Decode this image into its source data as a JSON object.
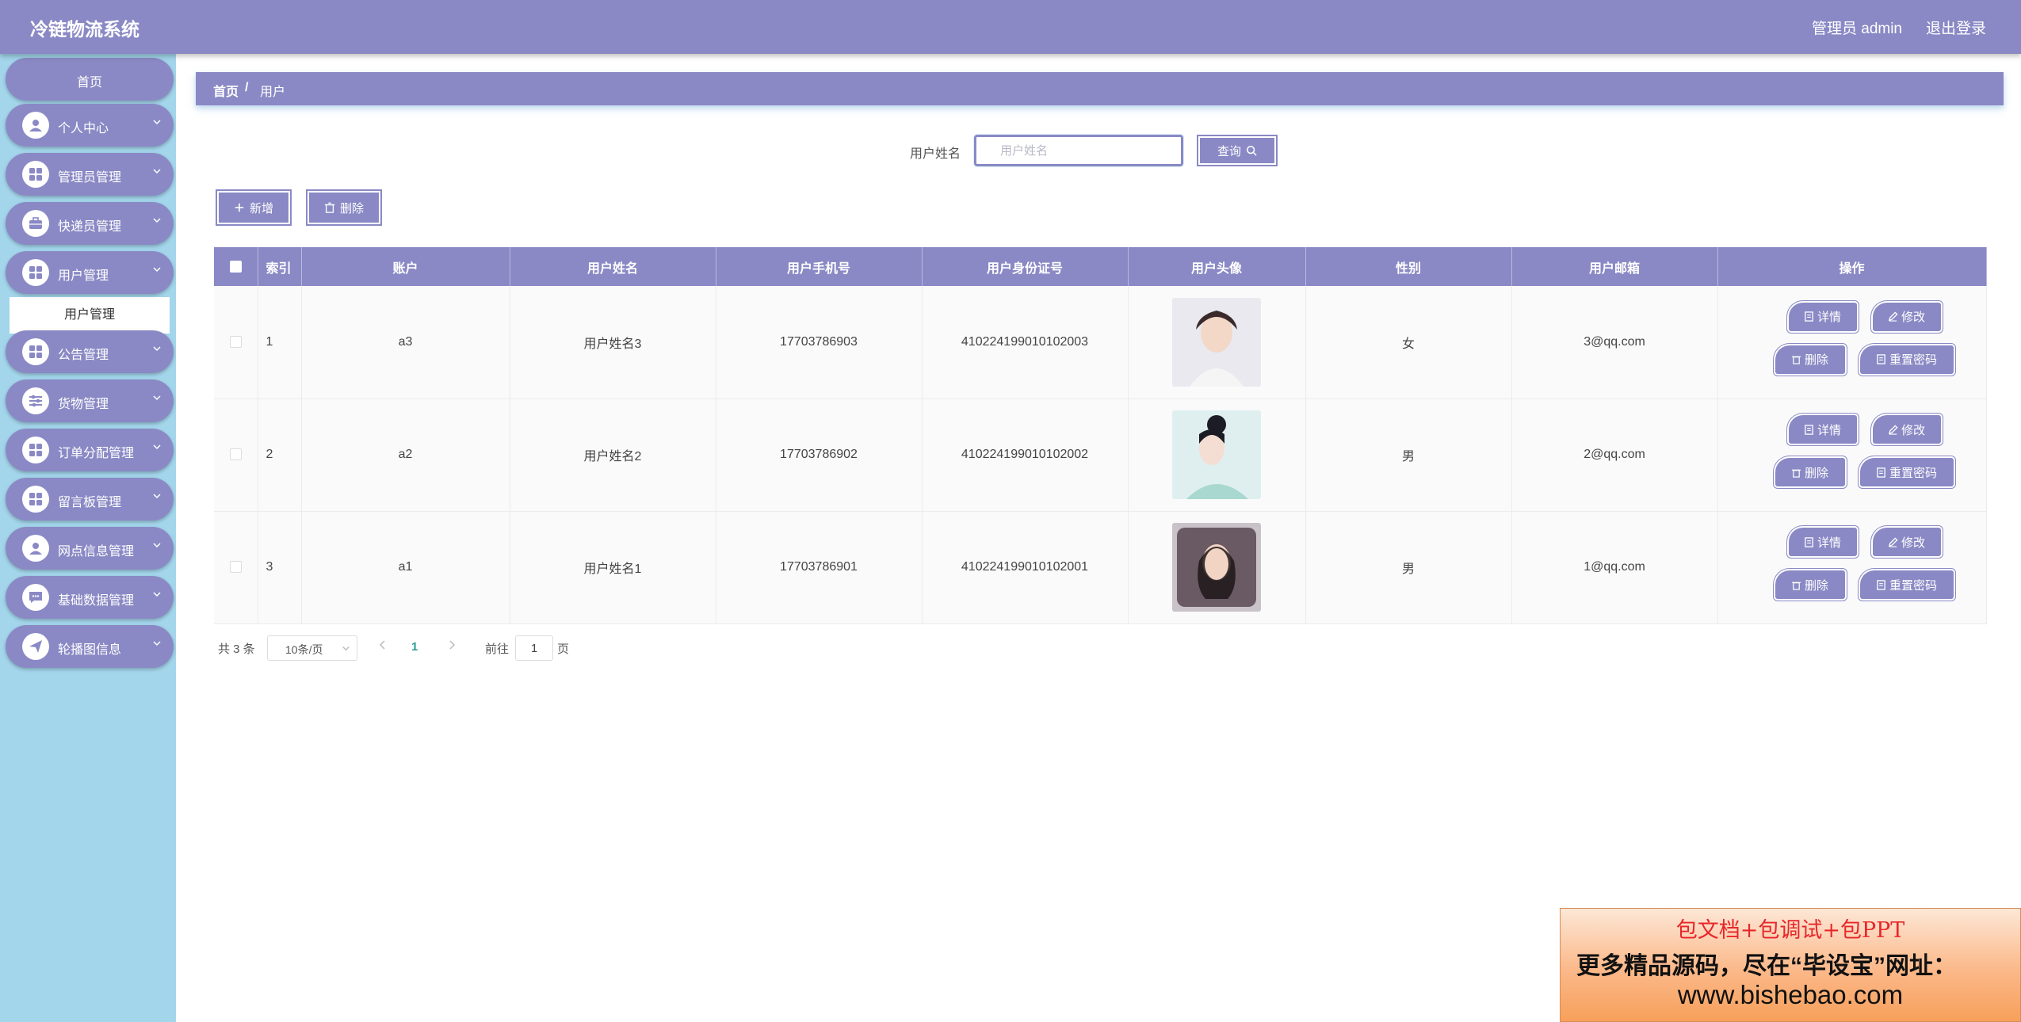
{
  "app": {
    "title": "冷链物流系统",
    "admin_label": "管理员 admin",
    "logout_label": "退出登录"
  },
  "sidebar": {
    "home": "首页",
    "items": [
      {
        "label": "个人中心",
        "icon": "person-icon"
      },
      {
        "label": "管理员管理",
        "icon": "grid-icon"
      },
      {
        "label": "快递员管理",
        "icon": "briefcase-icon"
      },
      {
        "label": "用户管理",
        "icon": "grid-icon"
      },
      {
        "label": "公告管理",
        "icon": "grid-icon"
      },
      {
        "label": "货物管理",
        "icon": "sliders-icon"
      },
      {
        "label": "订单分配管理",
        "icon": "grid-icon"
      },
      {
        "label": "留言板管理",
        "icon": "grid-icon"
      },
      {
        "label": "网点信息管理",
        "icon": "person-icon"
      },
      {
        "label": "基础数据管理",
        "icon": "chat-icon"
      },
      {
        "label": "轮播图信息",
        "icon": "send-icon"
      }
    ],
    "active_sub": "用户管理"
  },
  "breadcrumb": {
    "home": "首页",
    "sep": "/",
    "current": "用户"
  },
  "search": {
    "label": "用户姓名",
    "placeholder": "用户姓名",
    "value": "",
    "button": "查询"
  },
  "actions": {
    "add": "新增",
    "delete": "删除"
  },
  "table": {
    "headers": [
      "索引",
      "账户",
      "用户姓名",
      "用户手机号",
      "用户身份证号",
      "用户头像",
      "性别",
      "用户邮箱",
      "操作"
    ],
    "rows": [
      {
        "index": "1",
        "account": "a3",
        "name": "用户姓名3",
        "phone": "17703786903",
        "id_card": "410224199010102003",
        "gender": "女",
        "email": "3@qq.com"
      },
      {
        "index": "2",
        "account": "a2",
        "name": "用户姓名2",
        "phone": "17703786902",
        "id_card": "410224199010102002",
        "gender": "男",
        "email": "2@qq.com"
      },
      {
        "index": "3",
        "account": "a1",
        "name": "用户姓名1",
        "phone": "17703786901",
        "id_card": "410224199010102001",
        "gender": "男",
        "email": "1@qq.com"
      }
    ],
    "row_actions": {
      "detail": "详情",
      "edit": "修改",
      "delete": "删除",
      "reset": "重置密码"
    }
  },
  "pagination": {
    "total": "共 3 条",
    "page_size": "10条/页",
    "current": "1",
    "goto_label": "前往",
    "goto_value": "1",
    "page_suffix": "页"
  },
  "ad": {
    "line1": "包文档+包调试+包PPT",
    "line2": "更多精品源码，尽在“毕设宝”网址：",
    "line3": "www.bishebao.com"
  },
  "colors": {
    "primary": "#8a89c5",
    "sidebar_bg": "#a3d5eb",
    "accent_page": "#2a9d8f"
  }
}
